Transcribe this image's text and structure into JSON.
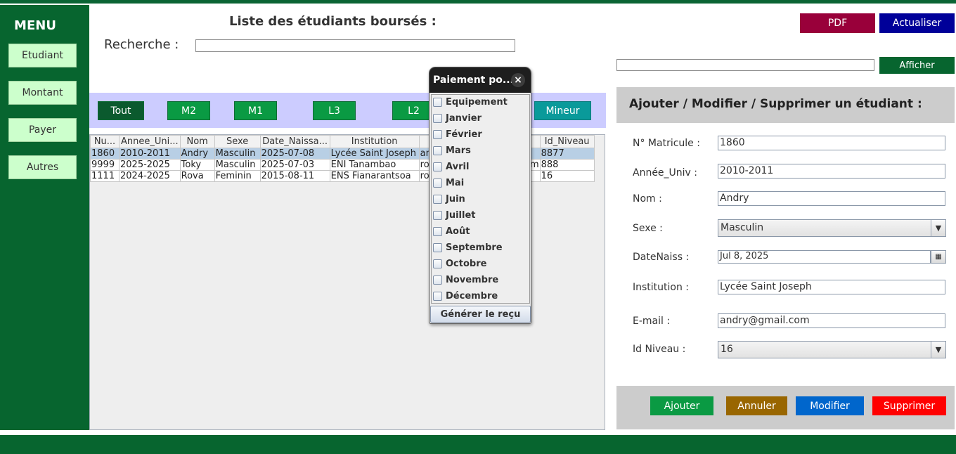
{
  "menu": {
    "title": "MENU",
    "items": [
      "Etudiant",
      "Montant",
      "Payer",
      "Autres"
    ]
  },
  "list": {
    "title": "Liste des étudiants boursés :",
    "search_label": "Recherche :",
    "search_value": ""
  },
  "filters": [
    "Tout",
    "M2",
    "M1",
    "L3",
    "L2",
    "Mineur"
  ],
  "table": {
    "headers": [
      "Nu...",
      "Annee_Uni...",
      "Nom",
      "Sexe",
      "Date_Naissa...",
      "Institution",
      "",
      "",
      "Id_Niveau"
    ],
    "rows": [
      [
        "1860",
        "2010-2011",
        "Andry",
        "Masculin",
        "2025-07-08",
        "Lycée Saint Joseph",
        "an",
        "",
        "8877"
      ],
      [
        "9999",
        "2025-2025",
        "Toky",
        "Masculin",
        "2025-07-03",
        "ENI Tanambao",
        "rob",
        "m",
        "888"
      ],
      [
        "1111",
        "2024-2025",
        "Rova",
        "Feminin",
        "2015-08-11",
        "ENS Fianarantsoa",
        "rov",
        "",
        "16"
      ]
    ]
  },
  "popup": {
    "title": "Paiement po...",
    "close": "×",
    "items": [
      "Equipement",
      "Janvier",
      "Février",
      "Mars",
      "Avril",
      "Mai",
      "Juin",
      "Juillet",
      "Août",
      "Septembre",
      "Octobre",
      "Novembre",
      "Décembre"
    ],
    "generate": "Générer le reçu"
  },
  "top_buttons": {
    "pdf": "PDF",
    "refresh": "Actualiser",
    "show": "Afficher"
  },
  "colors": {
    "sidebar": "#07652f",
    "pdf": "#99003a",
    "refresh": "#000099",
    "filter_band": "#ccccff"
  },
  "form": {
    "title": "Ajouter / Modifier / Supprimer un étudiant :",
    "matricule_label": "N° Matricule :",
    "matricule": "1860",
    "annee_label": "Année_Univ :",
    "annee": "2010-2011",
    "nom_label": "Nom :",
    "nom": "Andry",
    "sexe_label": "Sexe :",
    "sexe": "Masculin",
    "date_label": "DateNaiss :",
    "date": "Jul 8, 2025",
    "institution_label": "Institution :",
    "institution": "Lycée Saint Joseph",
    "email_label": "E-mail :",
    "email": "andry@gmail.com",
    "niveau_label": "Id Niveau :",
    "niveau": "16",
    "buttons": {
      "add": "Ajouter",
      "cancel": "Annuler",
      "modify": "Modifier",
      "delete": "Supprimer"
    }
  }
}
